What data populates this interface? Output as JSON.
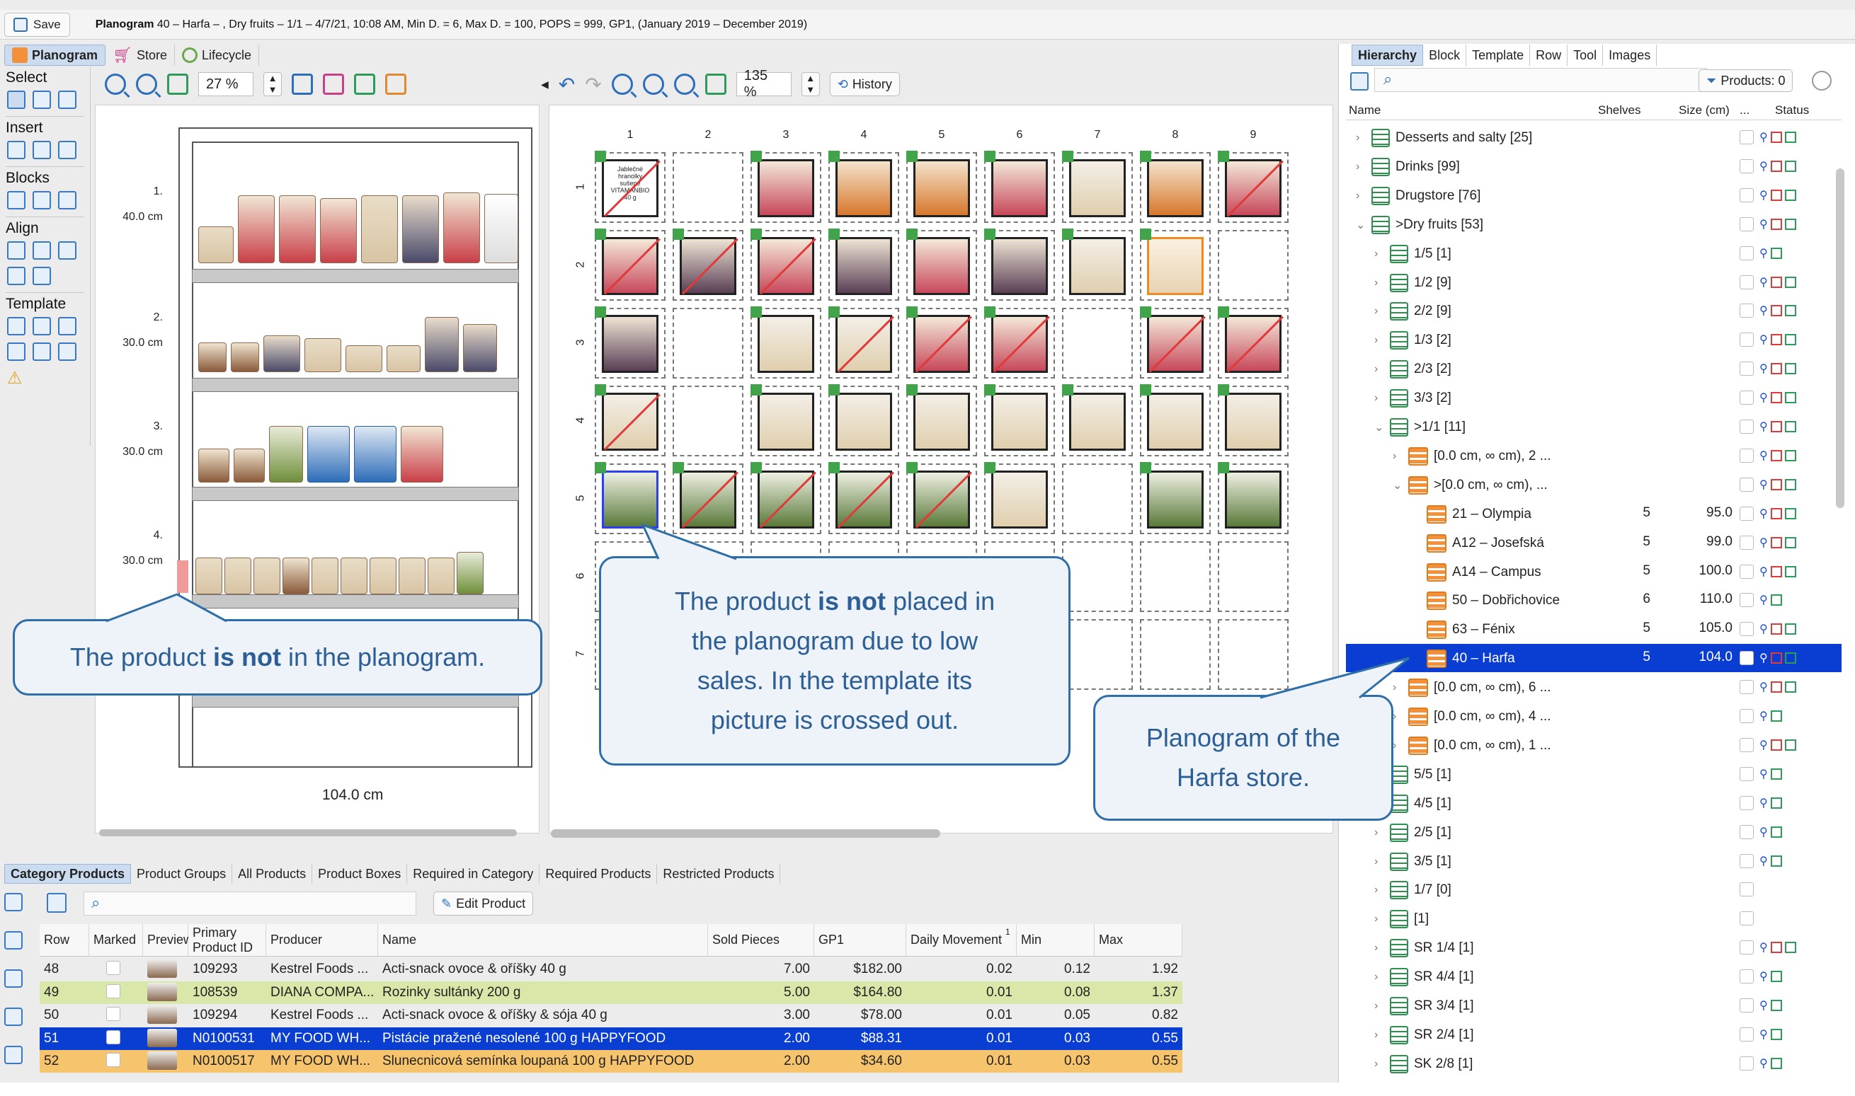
{
  "titlebar": {
    "save_label": "Save",
    "planogram_label": "Planogram",
    "planogram_title": " 40 – Harfa – , Dry fruits – 1/1 – 4/7/21, 10:08 AM, Min D. = 6, Max D. = 100, POPS = 999, GP1, (January 2019 – December 2019)"
  },
  "tabs": {
    "planogram": "Planogram",
    "store": "Store",
    "lifecycle": "Lifecycle"
  },
  "toolbar": {
    "zoom_left": "27 %",
    "zoom_right": "135 %",
    "history": "History"
  },
  "left_tools": {
    "select": "Select",
    "insert": "Insert",
    "blocks": "Blocks",
    "align": "Align",
    "template": "Template"
  },
  "shelves": [
    {
      "num": "1.",
      "height": "40.0 cm"
    },
    {
      "num": "2.",
      "height": "30.0 cm"
    },
    {
      "num": "3.",
      "height": "30.0 cm"
    },
    {
      "num": "4.",
      "height": "30.0 cm"
    }
  ],
  "gondola_width": "104.0 cm",
  "grid": {
    "columns": [
      "1",
      "2",
      "3",
      "4",
      "5",
      "6",
      "7",
      "8",
      "9"
    ],
    "rows": [
      "1",
      "2",
      "3",
      "4",
      "5",
      "6",
      "7"
    ]
  },
  "callouts": {
    "not_in_plano_pre": "The product ",
    "not_in_plano_bold": "is not",
    "not_in_plano_post": " in the planogram.",
    "low_sales_l1_pre": "The product ",
    "low_sales_l1_bold": "is not",
    "low_sales_l1_post": " placed in",
    "low_sales_l2": "the planogram due to low",
    "low_sales_l3": "sales. In the template its",
    "low_sales_l4": "picture is crossed out.",
    "harfa_l1": "Planogram of the",
    "harfa_l2": "Harfa store."
  },
  "right_panel": {
    "tabs": [
      "Hierarchy",
      "Block",
      "Template",
      "Row",
      "Tool",
      "Images"
    ],
    "products_btn": "Products: 0",
    "cols": {
      "name": "Name",
      "shelves": "Shelves",
      "size": "Size (cm)",
      "dots": "...",
      "status": "Status"
    },
    "rows": [
      {
        "label": "Desserts and salty [25]",
        "indent": 0,
        "icon": "sheet",
        "shelves": "",
        "size": "",
        "status": "rr"
      },
      {
        "label": "Drinks [99]",
        "indent": 0,
        "icon": "sheet",
        "shelves": "",
        "size": "",
        "status": "rg"
      },
      {
        "label": "Drugstore [76]",
        "indent": 0,
        "icon": "sheet",
        "shelves": "",
        "size": "",
        "status": "rr"
      },
      {
        "label": ">Dry fruits [53]",
        "indent": 0,
        "icon": "sheet",
        "shelves": "",
        "size": "",
        "status": "rr",
        "open": true
      },
      {
        "label": "1/5 [1]",
        "indent": 1,
        "icon": "sheet",
        "shelves": "",
        "size": "",
        "status": "g"
      },
      {
        "label": "1/2 [9]",
        "indent": 1,
        "icon": "sheet",
        "shelves": "",
        "size": "",
        "status": "rg"
      },
      {
        "label": "2/2 [9]",
        "indent": 1,
        "icon": "sheet",
        "shelves": "",
        "size": "",
        "status": "rg"
      },
      {
        "label": "1/3 [2]",
        "indent": 1,
        "icon": "sheet",
        "shelves": "",
        "size": "",
        "status": "rg"
      },
      {
        "label": "2/3 [2]",
        "indent": 1,
        "icon": "sheet",
        "shelves": "",
        "size": "",
        "status": "rg"
      },
      {
        "label": "3/3 [2]",
        "indent": 1,
        "icon": "sheet",
        "shelves": "",
        "size": "",
        "status": "rg"
      },
      {
        "label": ">1/1 [11]",
        "indent": 1,
        "icon": "sheet",
        "shelves": "",
        "size": "",
        "status": "rg",
        "open": true
      },
      {
        "label": "[0.0 cm, ∞ cm), 2 ...",
        "indent": 2,
        "icon": "org",
        "shelves": "",
        "size": "",
        "status": "rg"
      },
      {
        "label": ">[0.0 cm, ∞ cm), ...",
        "indent": 2,
        "icon": "org",
        "shelves": "",
        "size": "",
        "status": "rg",
        "open": true
      },
      {
        "label": "21 – Olympia",
        "indent": 3,
        "icon": "org",
        "shelves": "5",
        "size": "95.0",
        "status": "rg"
      },
      {
        "label": "A12 – Josefská",
        "indent": 3,
        "icon": "org",
        "shelves": "5",
        "size": "99.0",
        "status": "rg"
      },
      {
        "label": "A14 – Campus",
        "indent": 3,
        "icon": "org",
        "shelves": "5",
        "size": "100.0",
        "status": "rg"
      },
      {
        "label": "50 – Dobřichovice",
        "indent": 3,
        "icon": "org",
        "shelves": "6",
        "size": "110.0",
        "status": "g"
      },
      {
        "label": "63 – Fénix",
        "indent": 3,
        "icon": "org",
        "shelves": "5",
        "size": "105.0",
        "status": "rg"
      },
      {
        "label": "40 – Harfa",
        "indent": 3,
        "icon": "org",
        "shelves": "5",
        "size": "104.0",
        "status": "rg",
        "selected": true
      },
      {
        "label": "[0.0 cm, ∞ cm), 6 ...",
        "indent": 2,
        "icon": "org",
        "shelves": "",
        "size": "",
        "status": "rg"
      },
      {
        "label": "[0.0 cm, ∞ cm), 4 ...",
        "indent": 2,
        "icon": "org",
        "shelves": "",
        "size": "",
        "status": "g"
      },
      {
        "label": "[0.0 cm, ∞ cm), 1 ...",
        "indent": 2,
        "icon": "org",
        "shelves": "",
        "size": "",
        "status": "rg"
      },
      {
        "label": "5/5 [1]",
        "indent": 1,
        "icon": "sheet",
        "shelves": "",
        "size": "",
        "status": "g"
      },
      {
        "label": "4/5 [1]",
        "indent": 1,
        "icon": "sheet",
        "shelves": "",
        "size": "",
        "status": "g"
      },
      {
        "label": "2/5 [1]",
        "indent": 1,
        "icon": "sheet",
        "shelves": "",
        "size": "",
        "status": "g"
      },
      {
        "label": "3/5 [1]",
        "indent": 1,
        "icon": "sheet",
        "shelves": "",
        "size": "",
        "status": "g"
      },
      {
        "label": "1/7 [0]",
        "indent": 1,
        "icon": "sheet",
        "shelves": "",
        "size": "",
        "status": ""
      },
      {
        "label": "[1]",
        "indent": 1,
        "icon": "sheet",
        "shelves": "",
        "size": "",
        "status": ""
      },
      {
        "label": "SR 1/4 [1]",
        "indent": 1,
        "icon": "sheet",
        "shelves": "",
        "size": "",
        "status": "rg"
      },
      {
        "label": "SR 4/4 [1]",
        "indent": 1,
        "icon": "sheet",
        "shelves": "",
        "size": "",
        "status": "g"
      },
      {
        "label": "SR 3/4 [1]",
        "indent": 1,
        "icon": "sheet",
        "shelves": "",
        "size": "",
        "status": "g"
      },
      {
        "label": "SR 2/4 [1]",
        "indent": 1,
        "icon": "sheet",
        "shelves": "",
        "size": "",
        "status": "g"
      },
      {
        "label": "SK 2/8 [1]",
        "indent": 1,
        "icon": "sheet",
        "shelves": "",
        "size": "",
        "status": "g"
      }
    ]
  },
  "bottom": {
    "tabs": [
      "Category Products",
      "Product Groups",
      "All Products",
      "Product Boxes",
      "Required in Category",
      "Required Products",
      "Restricted Products"
    ],
    "edit_product": "Edit Product",
    "columns": [
      "Row",
      "Marked",
      "Preview",
      "Primary Product ID",
      "Producer",
      "Name",
      "Sold Pieces",
      "GP1",
      "Daily Movement",
      "Min",
      "Max"
    ],
    "sort_indicator": "1",
    "rows": [
      {
        "row": "48",
        "pid": "109293",
        "producer": "Kestrel Foods ...",
        "name": "Acti-snack ovoce & oříšky 40 g",
        "sold": "7.00",
        "gp1": "$182.00",
        "daily": "0.02",
        "min": "0.12",
        "max": "1.92",
        "style": ""
      },
      {
        "row": "49",
        "pid": "108539",
        "producer": "DIANA COMPA...",
        "name": "Rozinky sultánky 200 g",
        "sold": "5.00",
        "gp1": "$164.80",
        "daily": "0.01",
        "min": "0.08",
        "max": "1.37",
        "style": "g"
      },
      {
        "row": "50",
        "pid": "109294",
        "producer": "Kestrel Foods ...",
        "name": "Acti-snack ovoce & oříšky & sója 40 g",
        "sold": "3.00",
        "gp1": "$78.00",
        "daily": "0.01",
        "min": "0.05",
        "max": "0.82",
        "style": ""
      },
      {
        "row": "51",
        "pid": "N0100531",
        "producer": "MY FOOD WH...",
        "name": "Pistácie pražené nesolené 100 g HAPPYFOOD",
        "sold": "2.00",
        "gp1": "$88.31",
        "daily": "0.01",
        "min": "0.03",
        "max": "0.55",
        "style": "sel"
      },
      {
        "row": "52",
        "pid": "N0100517",
        "producer": "MY FOOD WH...",
        "name": "Slunecnicová semínka loupaná 100 g HAPPYFOOD",
        "sold": "2.00",
        "gp1": "$34.60",
        "daily": "0.01",
        "min": "0.03",
        "max": "0.55",
        "style": "o"
      }
    ]
  },
  "grid_cell_text": {
    "r1c1": "Jablečné hranolky sušené VITAMANBIO 40 g"
  }
}
